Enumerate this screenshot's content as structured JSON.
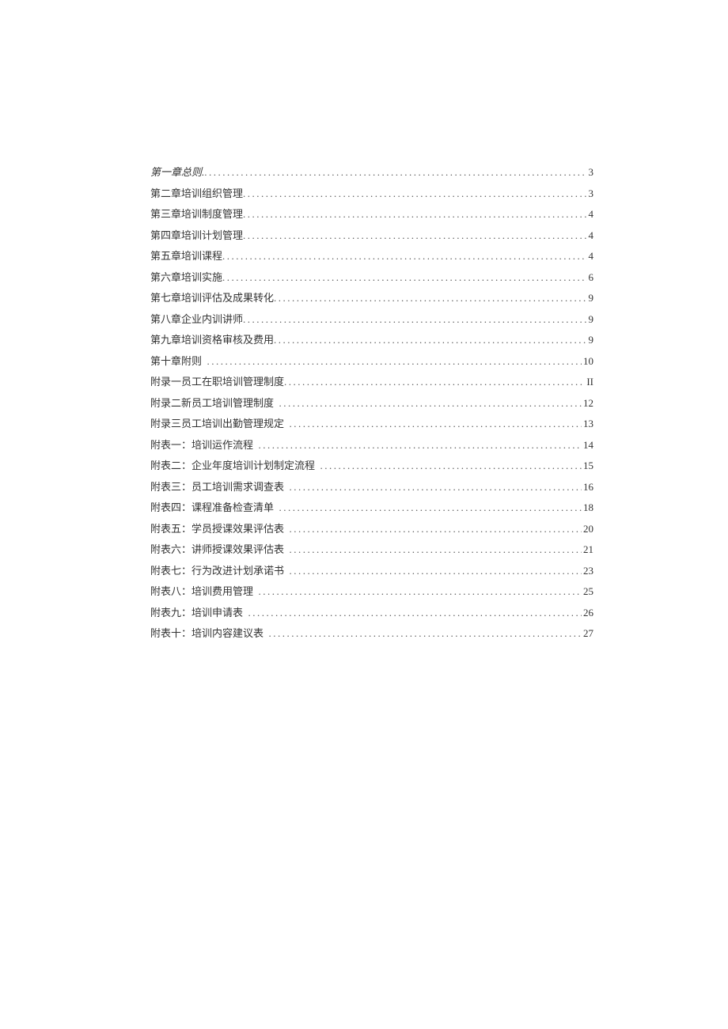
{
  "toc": [
    {
      "title": "第一章总则.",
      "page": "3",
      "italic": true,
      "space_after": false
    },
    {
      "title": "第二章培训组织管理",
      "page": "3",
      "italic": false,
      "space_after": false
    },
    {
      "title": "第三章培训制度管理",
      "page": "4",
      "italic": false,
      "space_after": false
    },
    {
      "title": "第四章培训计划管理",
      "page": "4",
      "italic": false,
      "space_after": false
    },
    {
      "title": "第五章培训课程",
      "page": "4",
      "italic": false,
      "space_after": false
    },
    {
      "title": "第六章培训实施",
      "page": "6",
      "italic": false,
      "space_after": false
    },
    {
      "title": "第七章培训评估及成果转化",
      "page": "9",
      "italic": false,
      "space_after": false
    },
    {
      "title": "第八章企业内训讲师",
      "page": "9",
      "italic": false,
      "space_after": false
    },
    {
      "title": "第九章培训资格审核及费用",
      "page": "9",
      "italic": false,
      "space_after": false
    },
    {
      "title": "第十章附则",
      "page": "10",
      "italic": false,
      "space_after": true
    },
    {
      "title": "附录一员工在职培训管理制度",
      "page": "II",
      "italic": false,
      "space_after": false
    },
    {
      "title": "附录二新员工培训管理制度",
      "page": "12",
      "italic": false,
      "space_after": true
    },
    {
      "title": "附录三员工培训出勤管理规定",
      "page": "13",
      "italic": false,
      "space_after": true
    },
    {
      "title": "附表一：培训运作流程",
      "page": "14",
      "italic": false,
      "space_after": true
    },
    {
      "title": "附表二：企业年度培训计划制定流程",
      "page": "15",
      "italic": false,
      "space_after": true
    },
    {
      "title": "附表三：员工培训需求调查表",
      "page": "16",
      "italic": false,
      "space_after": true
    },
    {
      "title": "附表四：课程准备检查清单",
      "page": "18",
      "italic": false,
      "space_after": true
    },
    {
      "title": "附表五：学员授课效果评估表",
      "page": "20",
      "italic": false,
      "space_after": true
    },
    {
      "title": "附表六：讲师授课效果评估表",
      "page": "21",
      "italic": false,
      "space_after": true
    },
    {
      "title": "附表七：行为改进计划承诺书",
      "page": "23",
      "italic": false,
      "space_after": true
    },
    {
      "title": "附表八：培训费用管理",
      "page": "25",
      "italic": false,
      "space_after": true
    },
    {
      "title": "附表九：培训申请表",
      "page": "26",
      "italic": false,
      "space_after": true
    },
    {
      "title": "附表十：培训内容建议表",
      "page": "27",
      "italic": false,
      "space_after": true
    }
  ]
}
